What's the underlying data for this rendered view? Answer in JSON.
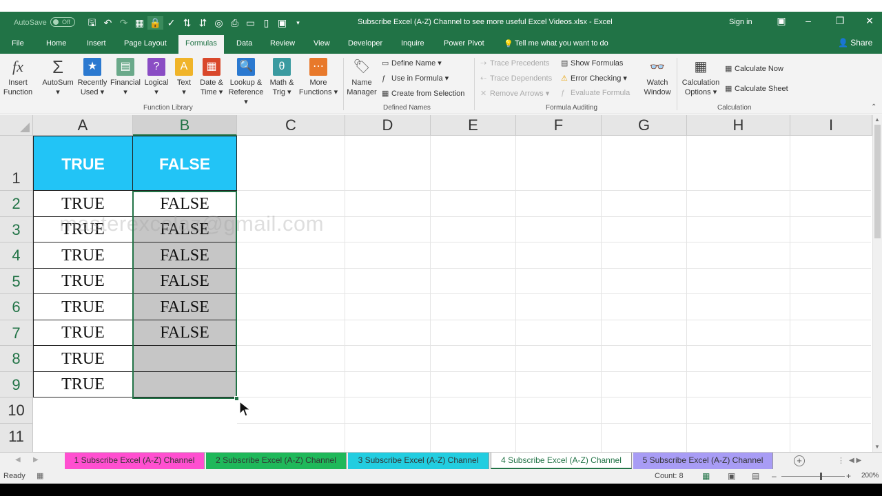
{
  "titlebar": {
    "autosave_label": "AutoSave",
    "autosave_state": "Off",
    "title": "Subscribe Excel (A-Z) Channel to see more useful Excel Videos.xlsx  -  Excel",
    "signin": "Sign in",
    "qat_icons": [
      "save-icon",
      "undo-icon",
      "redo-icon",
      "form-icon",
      "lock-icon",
      "spellcheck-icon",
      "sort-asc-icon",
      "sort-desc-icon",
      "camera-icon",
      "print-icon",
      "open-folder-icon",
      "new-file-icon",
      "table-icon",
      "customize-qat-icon"
    ]
  },
  "tabs": {
    "items": [
      "File",
      "Home",
      "Insert",
      "Page Layout",
      "Formulas",
      "Data",
      "Review",
      "View",
      "Developer",
      "Inquire",
      "Power Pivot"
    ],
    "active": "Formulas",
    "tell_me": "Tell me what you want to do",
    "share": "Share"
  },
  "ribbon": {
    "function_library": {
      "name": "Function Library",
      "insert_function": [
        "Insert",
        "Function"
      ],
      "autosum": [
        "AutoSum",
        "▾"
      ],
      "recently_used": [
        "Recently",
        "Used ▾"
      ],
      "financial": [
        "Financial",
        "▾"
      ],
      "logical": [
        "Logical",
        "▾"
      ],
      "text": [
        "Text",
        "▾"
      ],
      "date_time": [
        "Date &",
        "Time ▾"
      ],
      "lookup": [
        "Lookup &",
        "Reference ▾"
      ],
      "math": [
        "Math &",
        "Trig ▾"
      ],
      "more": [
        "More",
        "Functions ▾"
      ]
    },
    "defined_names": {
      "name": "Defined Names",
      "name_manager": [
        "Name",
        "Manager"
      ],
      "define_name": "Define Name  ▾",
      "use_in_formula": "Use in Formula ▾",
      "create_from_selection": "Create from Selection"
    },
    "formula_auditing": {
      "name": "Formula Auditing",
      "trace_precedents": "Trace Precedents",
      "trace_dependents": "Trace Dependents",
      "remove_arrows": "Remove Arrows  ▾",
      "show_formulas": "Show Formulas",
      "error_checking": "Error Checking   ▾",
      "evaluate_formula": "Evaluate Formula",
      "watch_window": [
        "Watch",
        "Window"
      ]
    },
    "calculation": {
      "name": "Calculation",
      "options": [
        "Calculation",
        "Options ▾"
      ],
      "calc_now": "Calculate Now",
      "calc_sheet": "Calculate Sheet"
    }
  },
  "sheet": {
    "columns": [
      "A",
      "B",
      "C",
      "D",
      "E",
      "F",
      "G",
      "H",
      "I"
    ],
    "rows": [
      "1",
      "2",
      "3",
      "4",
      "5",
      "6",
      "7",
      "8",
      "9",
      "10",
      "11"
    ],
    "header_a": "TRUE",
    "header_b": "FALSE",
    "col_a": [
      "TRUE",
      "TRUE",
      "TRUE",
      "TRUE",
      "TRUE",
      "TRUE",
      "TRUE",
      "TRUE"
    ],
    "col_b": [
      "FALSE",
      "FALSE",
      "FALSE",
      "FALSE",
      "FALSE",
      "FALSE",
      "",
      ""
    ],
    "watermark": "masterexcelaz@gmail.com",
    "header_fill": "#22c4f6"
  },
  "sheet_tabs": [
    {
      "label": "1 Subscribe Excel (A-Z) Channel",
      "color": "#ff4fd0"
    },
    {
      "label": "2 Subscribe Excel (A-Z) Channel",
      "color": "#1fb85a"
    },
    {
      "label": "3 Subscribe Excel (A-Z) Channel",
      "color": "#22cde0"
    },
    {
      "label": "4 Subscribe Excel (A-Z) Channel",
      "color": "#ffffff"
    },
    {
      "label": "5 Subscribe Excel (A-Z) Channel",
      "color": "#a89cf5"
    }
  ],
  "status": {
    "ready": "Ready",
    "count": "Count: 8",
    "zoom": "200%"
  }
}
